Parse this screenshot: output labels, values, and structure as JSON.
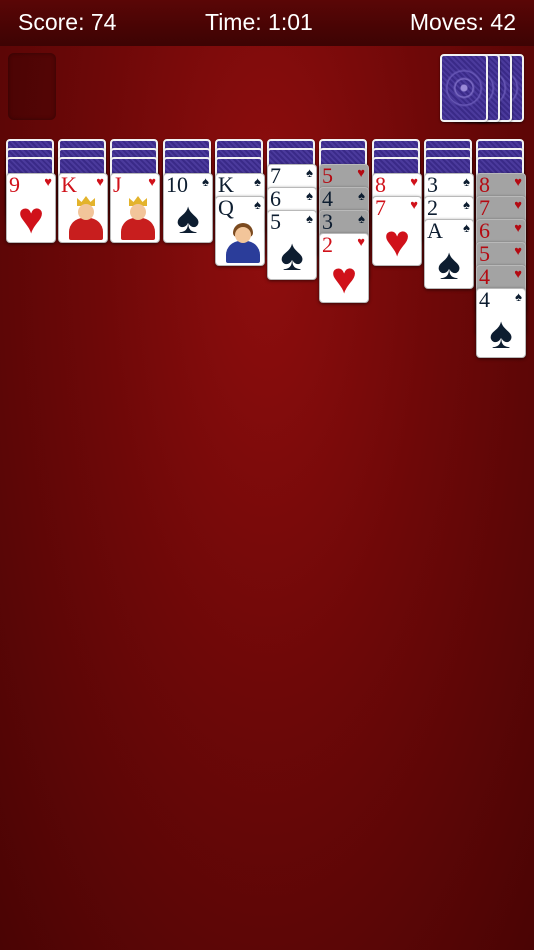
{
  "header": {
    "score": "Score: 74",
    "time": "Time: 1:01",
    "moves": "Moves: 42"
  },
  "theme": {
    "table_color": "#7a0a0a",
    "card_back_color": "#3c2c8c",
    "red_suit_color": "#d0111a",
    "black_suit_color": "#0d1d30"
  },
  "stock": {
    "piles_remaining": 4
  },
  "tableau": [
    {
      "hidden": 3,
      "cards": [
        {
          "rank": "9",
          "suit": "♥",
          "color": "red",
          "face": false,
          "dim": false
        }
      ]
    },
    {
      "hidden": 3,
      "cards": [
        {
          "rank": "K",
          "suit": "♥",
          "color": "red",
          "face": "king",
          "dim": false
        }
      ]
    },
    {
      "hidden": 3,
      "cards": [
        {
          "rank": "J",
          "suit": "♥",
          "color": "red",
          "face": "jack",
          "dim": false
        }
      ]
    },
    {
      "hidden": 3,
      "cards": [
        {
          "rank": "10",
          "suit": "♠",
          "color": "black",
          "face": false,
          "dim": false
        }
      ]
    },
    {
      "hidden": 3,
      "cards": [
        {
          "rank": "K",
          "suit": "♠",
          "color": "black",
          "face": false,
          "dim": false
        },
        {
          "rank": "Q",
          "suit": "♠",
          "color": "black",
          "face": "queen",
          "dim": false
        }
      ]
    },
    {
      "hidden": 2,
      "cards": [
        {
          "rank": "7",
          "suit": "♠",
          "color": "black",
          "face": false,
          "dim": false
        },
        {
          "rank": "6",
          "suit": "♠",
          "color": "black",
          "face": false,
          "dim": false
        },
        {
          "rank": "5",
          "suit": "♠",
          "color": "black",
          "face": false,
          "dim": false
        }
      ]
    },
    {
      "hidden": 2,
      "cards": [
        {
          "rank": "5",
          "suit": "♥",
          "color": "red",
          "face": false,
          "dim": true
        },
        {
          "rank": "4",
          "suit": "♠",
          "color": "black",
          "face": false,
          "dim": true
        },
        {
          "rank": "3",
          "suit": "♠",
          "color": "black",
          "face": false,
          "dim": true
        },
        {
          "rank": "2",
          "suit": "♥",
          "color": "red",
          "face": false,
          "dim": false
        }
      ]
    },
    {
      "hidden": 3,
      "cards": [
        {
          "rank": "8",
          "suit": "♥",
          "color": "red",
          "face": false,
          "dim": false
        },
        {
          "rank": "7",
          "suit": "♥",
          "color": "red",
          "face": false,
          "dim": false
        }
      ]
    },
    {
      "hidden": 3,
      "cards": [
        {
          "rank": "3",
          "suit": "♠",
          "color": "black",
          "face": false,
          "dim": false
        },
        {
          "rank": "2",
          "suit": "♠",
          "color": "black",
          "face": false,
          "dim": false
        },
        {
          "rank": "A",
          "suit": "♠",
          "color": "black",
          "face": false,
          "dim": false
        }
      ]
    },
    {
      "hidden": 3,
      "cards": [
        {
          "rank": "8",
          "suit": "♥",
          "color": "red",
          "face": false,
          "dim": true
        },
        {
          "rank": "7",
          "suit": "♥",
          "color": "red",
          "face": false,
          "dim": true
        },
        {
          "rank": "6",
          "suit": "♥",
          "color": "red",
          "face": false,
          "dim": true
        },
        {
          "rank": "5",
          "suit": "♥",
          "color": "red",
          "face": false,
          "dim": true
        },
        {
          "rank": "4",
          "suit": "♥",
          "color": "red",
          "face": false,
          "dim": true
        },
        {
          "rank": "4",
          "suit": "♠",
          "color": "black",
          "face": false,
          "dim": false
        }
      ]
    }
  ]
}
